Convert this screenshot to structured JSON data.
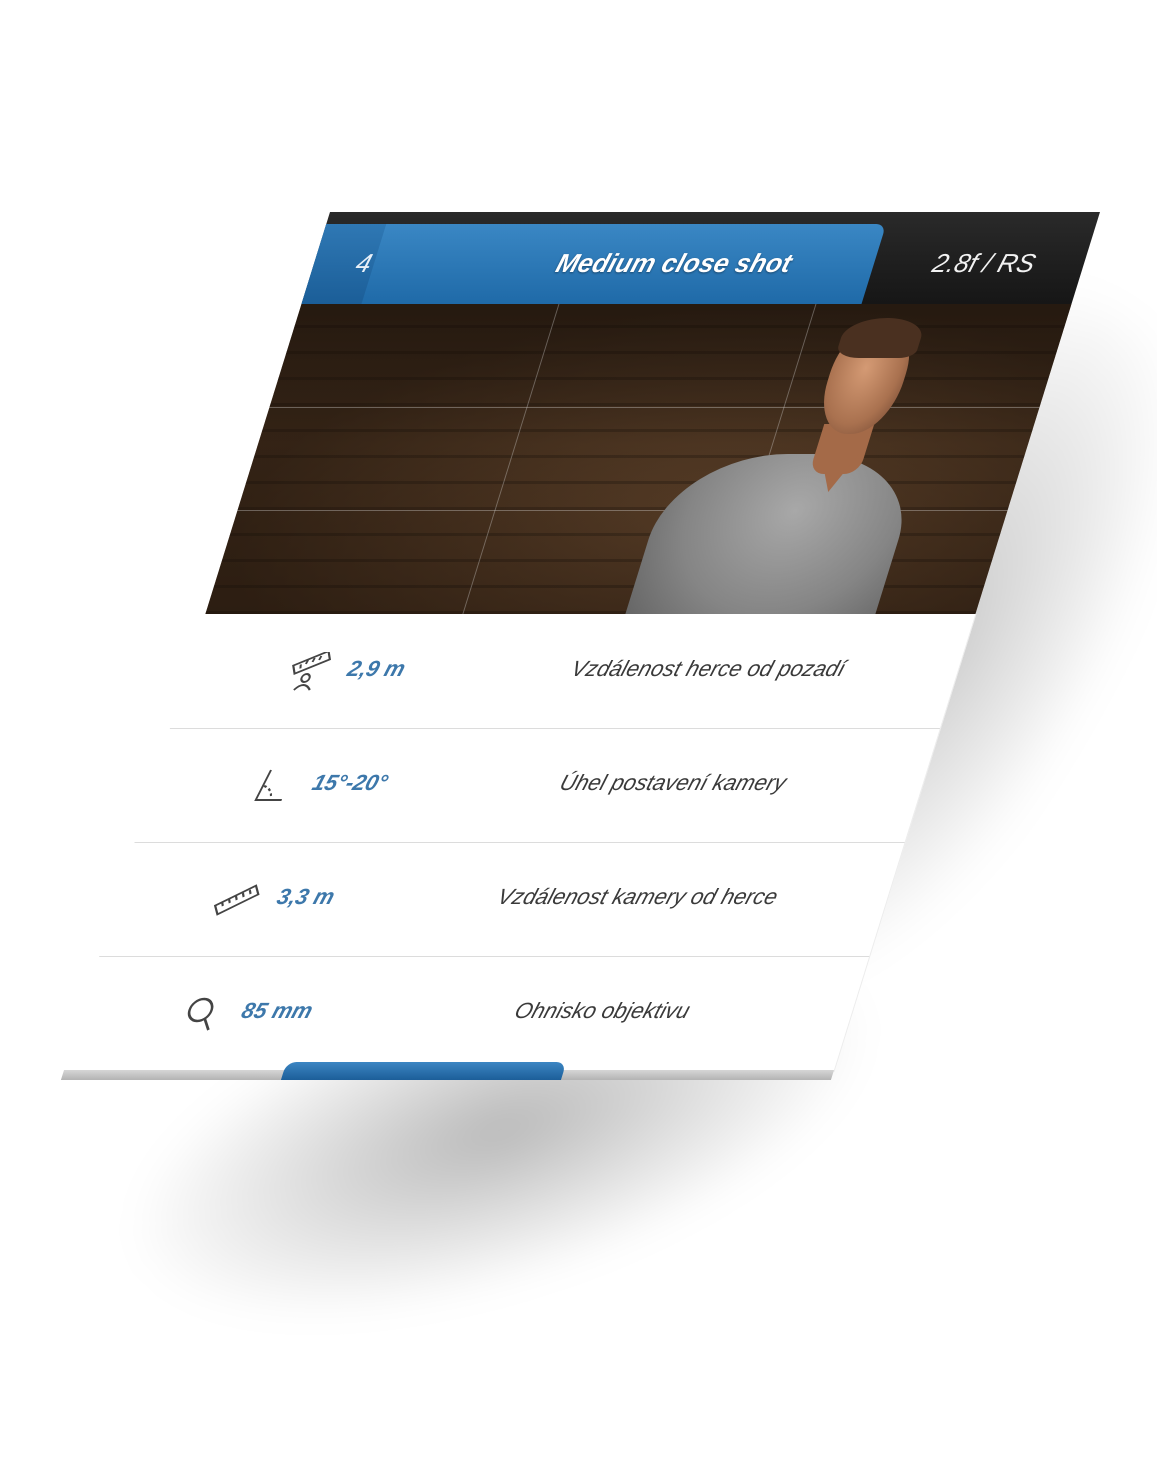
{
  "header": {
    "shot_number": "4",
    "shot_title": "Medium close shot",
    "aperture": "2.8f / RS"
  },
  "photo": {
    "icon": "actor-photo"
  },
  "specs": [
    {
      "icon": "ruler-person-icon",
      "value": "2,9 m",
      "label": "Vzdálenost herce od pozadí"
    },
    {
      "icon": "angle-icon",
      "value": "15°-20°",
      "label": "Úhel postavení kamery"
    },
    {
      "icon": "ruler-icon",
      "value": "3,3 m",
      "label": "Vzdálenost kamery od herce"
    },
    {
      "icon": "lens-magnifier-icon",
      "value": "85 mm",
      "label": "Ohnisko objektivu"
    }
  ],
  "colors": {
    "accent": "#2f78b4",
    "value_text": "#3d78ab",
    "topbar": "#1e1e1e"
  }
}
